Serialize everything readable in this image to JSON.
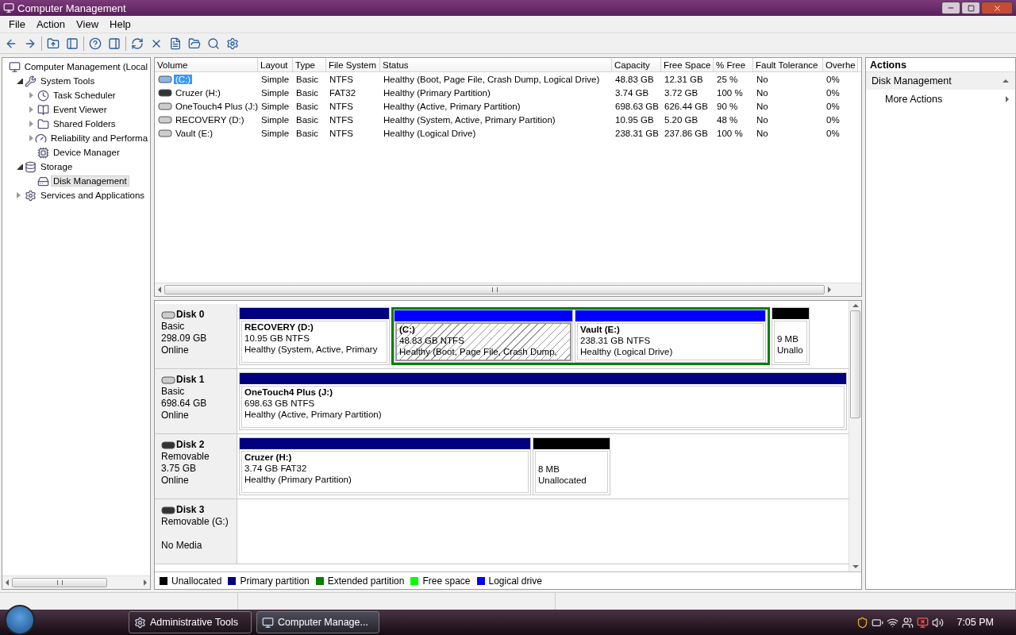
{
  "window": {
    "title": "Computer Management"
  },
  "menu": [
    "File",
    "Action",
    "View",
    "Help"
  ],
  "tree": [
    {
      "label": "Computer Management (Local",
      "selected": false,
      "children": [
        {
          "label": "System Tools",
          "expanded": true,
          "selected": false,
          "children": [
            {
              "label": "Task Scheduler",
              "expanded": false,
              "selected": false
            },
            {
              "label": "Event Viewer",
              "expanded": false,
              "selected": false
            },
            {
              "label": "Shared Folders",
              "expanded": false,
              "selected": false
            },
            {
              "label": "Reliability and Performa",
              "expanded": false,
              "selected": false
            },
            {
              "label": "Device Manager",
              "selected": false
            }
          ]
        },
        {
          "label": "Storage",
          "expanded": true,
          "selected": false,
          "children": [
            {
              "label": "Disk Management",
              "selected": true
            }
          ]
        },
        {
          "label": "Services and Applications",
          "expanded": false,
          "selected": false
        }
      ]
    }
  ],
  "volumes": {
    "columns": [
      "Volume",
      "Layout",
      "Type",
      "File System",
      "Status",
      "Capacity",
      "Free Space",
      "% Free",
      "Fault Tolerance",
      "Overhe"
    ],
    "rows": [
      {
        "selected": true,
        "cells": [
          "(C:)",
          "Simple",
          "Basic",
          "NTFS",
          "Healthy (Boot, Page File, Crash Dump, Logical Drive)",
          "48.83 GB",
          "12.31 GB",
          "25 %",
          "No",
          "0%"
        ]
      },
      {
        "selected": false,
        "cells": [
          "Cruzer (H:)",
          "Simple",
          "Basic",
          "FAT32",
          "Healthy (Primary Partition)",
          "3.74 GB",
          "3.72 GB",
          "100 %",
          "No",
          "0%"
        ]
      },
      {
        "selected": false,
        "cells": [
          "OneTouch4 Plus (J:)",
          "Simple",
          "Basic",
          "NTFS",
          "Healthy (Active, Primary Partition)",
          "698.63 GB",
          "626.44 GB",
          "90 %",
          "No",
          "0%"
        ]
      },
      {
        "selected": false,
        "cells": [
          "RECOVERY (D:)",
          "Simple",
          "Basic",
          "NTFS",
          "Healthy (System, Active, Primary Partition)",
          "10.95 GB",
          "5.20 GB",
          "48 %",
          "No",
          "0%"
        ]
      },
      {
        "selected": false,
        "cells": [
          "Vault (E:)",
          "Simple",
          "Basic",
          "NTFS",
          "Healthy (Logical Drive)",
          "238.31 GB",
          "237.86 GB",
          "100 %",
          "No",
          "0%"
        ]
      }
    ]
  },
  "disks": [
    {
      "name": "Disk 0",
      "type": "Basic",
      "size": "298.09 GB",
      "status": "Online",
      "partitions": [
        {
          "kind": "primary",
          "name": "RECOVERY  (D:)",
          "size": "10.95 GB NTFS",
          "status": "Healthy (System, Active, Primary",
          "selected": false
        },
        {
          "kind": "extended",
          "children": [
            {
              "kind": "logical",
              "name": "(C:)",
              "size": "48.83 GB NTFS",
              "status": "Healthy (Boot, Page File, Crash Dump,",
              "selected": true
            },
            {
              "kind": "logical",
              "name": "Vault  (E:)",
              "size": "238.31 GB NTFS",
              "status": "Healthy (Logical Drive)",
              "selected": false
            }
          ]
        },
        {
          "kind": "unallocated",
          "size": "9 MB",
          "status": "Unallo",
          "selected": false
        }
      ]
    },
    {
      "name": "Disk 1",
      "type": "Basic",
      "size": "698.64 GB",
      "status": "Online",
      "partitions": [
        {
          "kind": "primary",
          "name": "OneTouch4 Plus  (J:)",
          "size": "698.63 GB NTFS",
          "status": "Healthy (Active, Primary Partition)",
          "selected": false
        }
      ]
    },
    {
      "name": "Disk 2",
      "type": "Removable",
      "size": "3.75 GB",
      "status": "Online",
      "partitions": [
        {
          "kind": "primary",
          "name": "Cruzer  (H:)",
          "size": "3.74 GB FAT32",
          "status": "Healthy (Primary Partition)",
          "selected": false
        },
        {
          "kind": "unallocated",
          "size": "8 MB",
          "status": "Unallocated",
          "selected": false
        }
      ]
    },
    {
      "name": "Disk 3",
      "type": "Removable (G:)",
      "status": "No Media"
    }
  ],
  "legend": [
    {
      "label": "Unallocated",
      "color": "#000000"
    },
    {
      "label": "Primary partition",
      "color": "#000080"
    },
    {
      "label": "Extended partition",
      "color": "#008000"
    },
    {
      "label": "Free space",
      "color": "#00ff00"
    },
    {
      "label": "Logical drive",
      "color": "#0000ff"
    }
  ],
  "actions": {
    "title": "Actions",
    "section": "Disk Management",
    "items": [
      "More Actions"
    ]
  },
  "taskbar": {
    "tasks": [
      {
        "label": "Administrative Tools",
        "selected": false
      },
      {
        "label": "Computer Manage...",
        "selected": true
      }
    ],
    "clock": "7:05 PM"
  }
}
